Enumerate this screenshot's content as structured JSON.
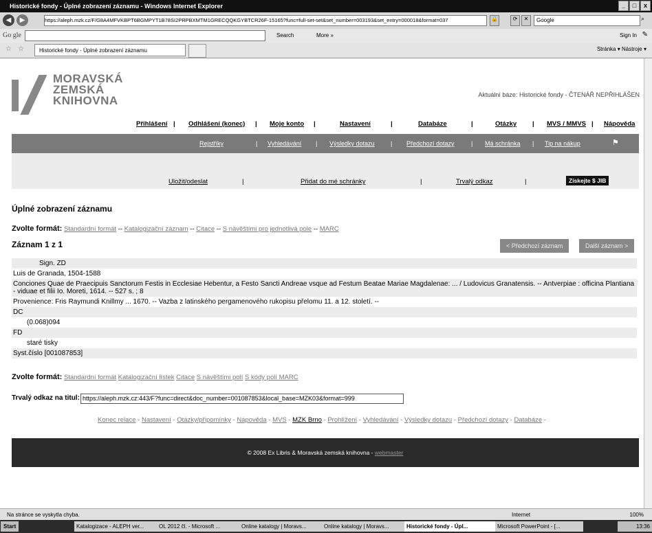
{
  "window": {
    "title": "Historické fondy - Úplné zobrazení záznamu - Windows Internet Explorer",
    "min": "_",
    "max": "□",
    "close": "x"
  },
  "address": {
    "url": "https://aleph.mzk.cz/F/G8A4MFVKBPT6BGMPYT1B78SI2PRPBXMTM1GRECQQKGYBTCR26F-15165?func=full-set-set&set_number=003193&set_entry=000018&format=037",
    "search_placeholder": "Google"
  },
  "google": {
    "logo": "Go gle",
    "search": "Search",
    "more": "More »",
    "signin": "Sign In"
  },
  "tab": {
    "label": "Historické fondy - Úplné zobrazení záznamu",
    "tools": "Stránka ▾  Nástroje ▾"
  },
  "logo": {
    "line1": "MORAVSKÁ",
    "line2": "ZEMSKÁ",
    "line3": "KNIHOVNA"
  },
  "current_base": "Aktuální báze: Historické fondy - ČTENÁŘ NEPŘIHLÁŠEN",
  "topnav": [
    "Přihlášení",
    "Odhlášení (konec)",
    "Moje konto",
    "Nastavení",
    "Databáze",
    "Otázky",
    "MVS / MMVS",
    "Nápověda"
  ],
  "graynav": [
    "Rejstříky",
    "Vyhledávání",
    "Výsledky dotazu",
    "Předchozí dotazy",
    "Má schránka",
    "Tip na nákup"
  ],
  "actions": [
    "Uložit/odeslat",
    "Přidat do mé schránky",
    "Trvalý odkaz"
  ],
  "jib_button": "Získejte $ JIB",
  "heading": "Úplné zobrazení záznamu",
  "format1": {
    "label": "Zvolte formát:",
    "links": [
      "Standardní formát",
      "Katalogizační záznam",
      "Citace",
      "S návěštími pro jednotlivá pole",
      "MARC"
    ]
  },
  "record": {
    "counter": "Záznam 1 z 1",
    "prev": "< Předchozí záznam",
    "next": "Další záznam >"
  },
  "rows": [
    "Sign. ZD",
    "Luis de Granada, 1504-1588",
    "Conciones Quae de Praecipuis Sanctorum Festis in Ecclesiae Hebentur, a Festo Sancti Andreae vsque ad Festum Beatae Mariae Magdalenae: ... / Ludovicus Granatensis. -- Antverpiae : officina Plantiana - viduae et filii Io. Moreti, 1614. -- 527 s. ; 8",
    "Provenience: Fris Raymundi Knillmy ... 1670. --  Vazba z latinského pergamenového rukopisu přelomu 11. a 12. století. --",
    "DC",
    "(0.068)094",
    "FD",
    "staré tisky",
    "Syst.číslo [001087853]"
  ],
  "format2": {
    "label": "Zvolte formát:",
    "links": [
      "Standardní formát",
      "Katalogizační lístek",
      "Citace",
      "S návěštími polí",
      "S kódy polí MARC"
    ]
  },
  "permalink": {
    "label": "Trvalý odkaz na titul:",
    "value": "https://aleph.mzk.cz:443/F?func=direct&doc_number=001087853&local_base=MZK03&format=999"
  },
  "footer_links": [
    "Konec relace",
    "Nastavení",
    "Otázky/připomínky",
    "Nápověda",
    "MVS",
    "MZK Brno",
    "Prohlížení",
    "Vyhledávání",
    "Výsledky dotazu",
    "Předchozí dotazy",
    "Databáze"
  ],
  "copyright": "© 2008 Ex Libris & Moravská zemská knihovna - ",
  "webmaster": "webmaster",
  "status": {
    "message": "Na stránce se vyskytla chyba.",
    "zone": "Internet",
    "zoom": "100%"
  },
  "taskbar": {
    "start": "Start",
    "tasks": [
      "Katalogizace - ALEPH ver...",
      "OL 2012 čl. - Microsoft ...",
      "Online katalogy | Moravs...",
      "Online katalogy | Moravs...",
      "Historické fondy - Úpl...",
      "Microsoft PowerPoint - [..."
    ],
    "clock": "13:36"
  }
}
